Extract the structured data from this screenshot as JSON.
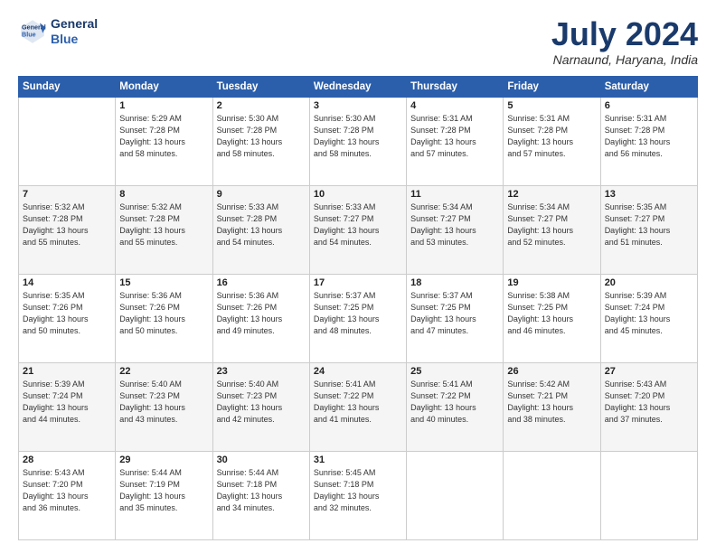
{
  "header": {
    "logo_line1": "General",
    "logo_line2": "Blue",
    "month_title": "July 2024",
    "location": "Narnaund, Haryana, India"
  },
  "calendar": {
    "days_of_week": [
      "Sunday",
      "Monday",
      "Tuesday",
      "Wednesday",
      "Thursday",
      "Friday",
      "Saturday"
    ],
    "weeks": [
      [
        {
          "day": "",
          "info": ""
        },
        {
          "day": "1",
          "info": "Sunrise: 5:29 AM\nSunset: 7:28 PM\nDaylight: 13 hours\nand 58 minutes."
        },
        {
          "day": "2",
          "info": "Sunrise: 5:30 AM\nSunset: 7:28 PM\nDaylight: 13 hours\nand 58 minutes."
        },
        {
          "day": "3",
          "info": "Sunrise: 5:30 AM\nSunset: 7:28 PM\nDaylight: 13 hours\nand 58 minutes."
        },
        {
          "day": "4",
          "info": "Sunrise: 5:31 AM\nSunset: 7:28 PM\nDaylight: 13 hours\nand 57 minutes."
        },
        {
          "day": "5",
          "info": "Sunrise: 5:31 AM\nSunset: 7:28 PM\nDaylight: 13 hours\nand 57 minutes."
        },
        {
          "day": "6",
          "info": "Sunrise: 5:31 AM\nSunset: 7:28 PM\nDaylight: 13 hours\nand 56 minutes."
        }
      ],
      [
        {
          "day": "7",
          "info": "Sunrise: 5:32 AM\nSunset: 7:28 PM\nDaylight: 13 hours\nand 55 minutes."
        },
        {
          "day": "8",
          "info": "Sunrise: 5:32 AM\nSunset: 7:28 PM\nDaylight: 13 hours\nand 55 minutes."
        },
        {
          "day": "9",
          "info": "Sunrise: 5:33 AM\nSunset: 7:28 PM\nDaylight: 13 hours\nand 54 minutes."
        },
        {
          "day": "10",
          "info": "Sunrise: 5:33 AM\nSunset: 7:27 PM\nDaylight: 13 hours\nand 54 minutes."
        },
        {
          "day": "11",
          "info": "Sunrise: 5:34 AM\nSunset: 7:27 PM\nDaylight: 13 hours\nand 53 minutes."
        },
        {
          "day": "12",
          "info": "Sunrise: 5:34 AM\nSunset: 7:27 PM\nDaylight: 13 hours\nand 52 minutes."
        },
        {
          "day": "13",
          "info": "Sunrise: 5:35 AM\nSunset: 7:27 PM\nDaylight: 13 hours\nand 51 minutes."
        }
      ],
      [
        {
          "day": "14",
          "info": "Sunrise: 5:35 AM\nSunset: 7:26 PM\nDaylight: 13 hours\nand 50 minutes."
        },
        {
          "day": "15",
          "info": "Sunrise: 5:36 AM\nSunset: 7:26 PM\nDaylight: 13 hours\nand 50 minutes."
        },
        {
          "day": "16",
          "info": "Sunrise: 5:36 AM\nSunset: 7:26 PM\nDaylight: 13 hours\nand 49 minutes."
        },
        {
          "day": "17",
          "info": "Sunrise: 5:37 AM\nSunset: 7:25 PM\nDaylight: 13 hours\nand 48 minutes."
        },
        {
          "day": "18",
          "info": "Sunrise: 5:37 AM\nSunset: 7:25 PM\nDaylight: 13 hours\nand 47 minutes."
        },
        {
          "day": "19",
          "info": "Sunrise: 5:38 AM\nSunset: 7:25 PM\nDaylight: 13 hours\nand 46 minutes."
        },
        {
          "day": "20",
          "info": "Sunrise: 5:39 AM\nSunset: 7:24 PM\nDaylight: 13 hours\nand 45 minutes."
        }
      ],
      [
        {
          "day": "21",
          "info": "Sunrise: 5:39 AM\nSunset: 7:24 PM\nDaylight: 13 hours\nand 44 minutes."
        },
        {
          "day": "22",
          "info": "Sunrise: 5:40 AM\nSunset: 7:23 PM\nDaylight: 13 hours\nand 43 minutes."
        },
        {
          "day": "23",
          "info": "Sunrise: 5:40 AM\nSunset: 7:23 PM\nDaylight: 13 hours\nand 42 minutes."
        },
        {
          "day": "24",
          "info": "Sunrise: 5:41 AM\nSunset: 7:22 PM\nDaylight: 13 hours\nand 41 minutes."
        },
        {
          "day": "25",
          "info": "Sunrise: 5:41 AM\nSunset: 7:22 PM\nDaylight: 13 hours\nand 40 minutes."
        },
        {
          "day": "26",
          "info": "Sunrise: 5:42 AM\nSunset: 7:21 PM\nDaylight: 13 hours\nand 38 minutes."
        },
        {
          "day": "27",
          "info": "Sunrise: 5:43 AM\nSunset: 7:20 PM\nDaylight: 13 hours\nand 37 minutes."
        }
      ],
      [
        {
          "day": "28",
          "info": "Sunrise: 5:43 AM\nSunset: 7:20 PM\nDaylight: 13 hours\nand 36 minutes."
        },
        {
          "day": "29",
          "info": "Sunrise: 5:44 AM\nSunset: 7:19 PM\nDaylight: 13 hours\nand 35 minutes."
        },
        {
          "day": "30",
          "info": "Sunrise: 5:44 AM\nSunset: 7:18 PM\nDaylight: 13 hours\nand 34 minutes."
        },
        {
          "day": "31",
          "info": "Sunrise: 5:45 AM\nSunset: 7:18 PM\nDaylight: 13 hours\nand 32 minutes."
        },
        {
          "day": "",
          "info": ""
        },
        {
          "day": "",
          "info": ""
        },
        {
          "day": "",
          "info": ""
        }
      ]
    ]
  }
}
